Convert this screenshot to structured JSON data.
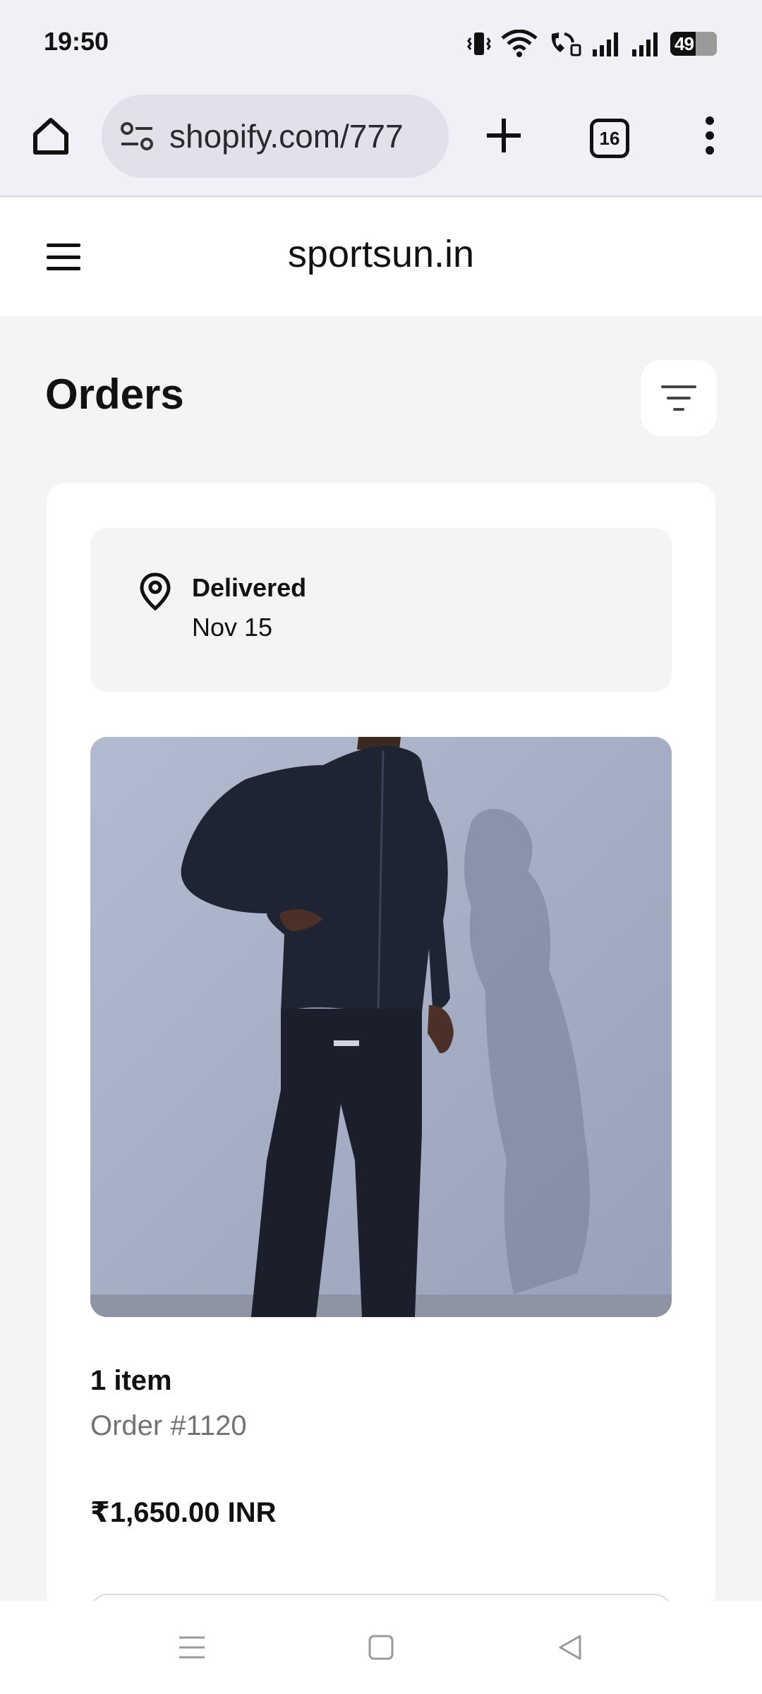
{
  "status_bar": {
    "time": "19:50",
    "battery_level": "49"
  },
  "browser": {
    "url": "shopify.com/777",
    "tab_count": "16"
  },
  "store": {
    "name": "sportsun.in"
  },
  "page": {
    "title": "Orders"
  },
  "orders": [
    {
      "status": "Delivered",
      "date": "Nov 15",
      "item_count": "1 item",
      "order_number": "Order #1120",
      "total": "₹1,650.00 INR",
      "image_icon": "product-photo-tracksuit"
    }
  ],
  "colors": {
    "background": "#f4f4f4",
    "card": "#ffffff",
    "chrome": "#f1f0f6",
    "muted_text": "#737373"
  }
}
